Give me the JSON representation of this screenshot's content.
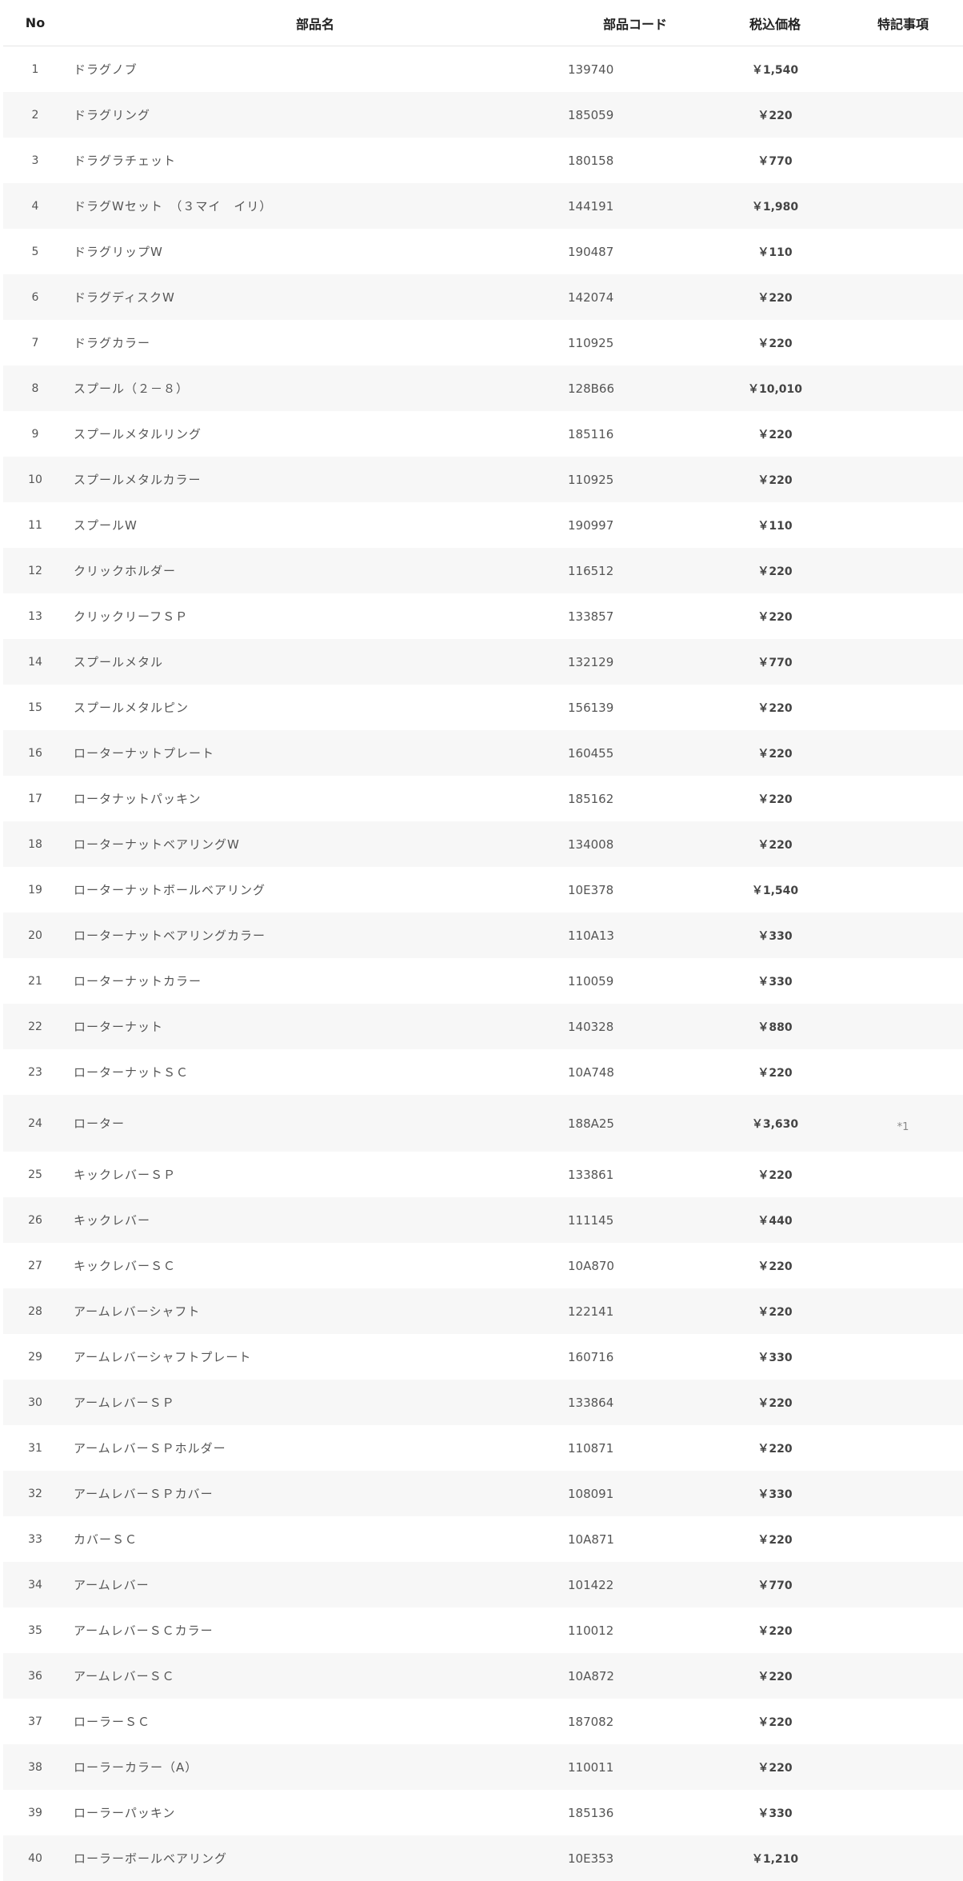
{
  "table": {
    "headers": {
      "no": "No",
      "name": "部品名",
      "code": "部品コード",
      "price": "税込価格",
      "note": "特記事項"
    },
    "rows": [
      {
        "no": "1",
        "name": "ドラグノブ",
        "code": "139740",
        "price": "￥1,540",
        "note": ""
      },
      {
        "no": "2",
        "name": "ドラグリング",
        "code": "185059",
        "price": "￥220",
        "note": ""
      },
      {
        "no": "3",
        "name": "ドラグラチェット",
        "code": "180158",
        "price": "￥770",
        "note": ""
      },
      {
        "no": "4",
        "name": "ドラグWセット　（３マイ　イリ）",
        "code": "144191",
        "price": "￥1,980",
        "note": ""
      },
      {
        "no": "5",
        "name": "ドラグリップW",
        "code": "190487",
        "price": "￥110",
        "note": ""
      },
      {
        "no": "6",
        "name": "ドラグディスクW",
        "code": "142074",
        "price": "￥220",
        "note": ""
      },
      {
        "no": "7",
        "name": "ドラグカラー",
        "code": "110925",
        "price": "￥220",
        "note": ""
      },
      {
        "no": "8",
        "name": "スプール（２－８）",
        "code": "128B66",
        "price": "￥10,010",
        "note": ""
      },
      {
        "no": "9",
        "name": "スプールメタルリング",
        "code": "185116",
        "price": "￥220",
        "note": ""
      },
      {
        "no": "10",
        "name": "スプールメタルカラー",
        "code": "110925",
        "price": "￥220",
        "note": ""
      },
      {
        "no": "11",
        "name": "スプールW",
        "code": "190997",
        "price": "￥110",
        "note": ""
      },
      {
        "no": "12",
        "name": "クリックホルダー",
        "code": "116512",
        "price": "￥220",
        "note": ""
      },
      {
        "no": "13",
        "name": "クリックリーフＳＰ",
        "code": "133857",
        "price": "￥220",
        "note": ""
      },
      {
        "no": "14",
        "name": "スプールメタル",
        "code": "132129",
        "price": "￥770",
        "note": ""
      },
      {
        "no": "15",
        "name": "スプールメタルピン",
        "code": "156139",
        "price": "￥220",
        "note": ""
      },
      {
        "no": "16",
        "name": "ローターナットプレート",
        "code": "160455",
        "price": "￥220",
        "note": ""
      },
      {
        "no": "17",
        "name": "ロータナットパッキン",
        "code": "185162",
        "price": "￥220",
        "note": ""
      },
      {
        "no": "18",
        "name": "ローターナットベアリングW",
        "code": "134008",
        "price": "￥220",
        "note": ""
      },
      {
        "no": "19",
        "name": "ローターナットボールベアリング",
        "code": "10E378",
        "price": "￥1,540",
        "note": ""
      },
      {
        "no": "20",
        "name": "ローターナットベアリングカラー",
        "code": "110A13",
        "price": "￥330",
        "note": ""
      },
      {
        "no": "21",
        "name": "ローターナットカラー",
        "code": "110059",
        "price": "￥330",
        "note": ""
      },
      {
        "no": "22",
        "name": "ローターナット",
        "code": "140328",
        "price": "￥880",
        "note": ""
      },
      {
        "no": "23",
        "name": "ローターナットＳＣ",
        "code": "10A748",
        "price": "￥220",
        "note": ""
      },
      {
        "no": "24",
        "name": "ローター",
        "code": "188A25",
        "price": "￥3,630",
        "note": "*1"
      },
      {
        "no": "25",
        "name": "キックレバーＳＰ",
        "code": "133861",
        "price": "￥220",
        "note": ""
      },
      {
        "no": "26",
        "name": "キックレバー",
        "code": "111145",
        "price": "￥440",
        "note": ""
      },
      {
        "no": "27",
        "name": "キックレバーＳＣ",
        "code": "10A870",
        "price": "￥220",
        "note": ""
      },
      {
        "no": "28",
        "name": "アームレバーシャフト",
        "code": "122141",
        "price": "￥220",
        "note": ""
      },
      {
        "no": "29",
        "name": "アームレバーシャフトプレート",
        "code": "160716",
        "price": "￥330",
        "note": ""
      },
      {
        "no": "30",
        "name": "アームレバーＳＰ",
        "code": "133864",
        "price": "￥220",
        "note": ""
      },
      {
        "no": "31",
        "name": "アームレバーＳＰホルダー",
        "code": "110871",
        "price": "￥220",
        "note": ""
      },
      {
        "no": "32",
        "name": "アームレバーＳＰカバー",
        "code": "108091",
        "price": "￥330",
        "note": ""
      },
      {
        "no": "33",
        "name": "カバーＳＣ",
        "code": "10A871",
        "price": "￥220",
        "note": ""
      },
      {
        "no": "34",
        "name": "アームレバー",
        "code": "101422",
        "price": "￥770",
        "note": ""
      },
      {
        "no": "35",
        "name": "アームレバーＳＣカラー",
        "code": "110012",
        "price": "￥220",
        "note": ""
      },
      {
        "no": "36",
        "name": "アームレバーＳＣ",
        "code": "10A872",
        "price": "￥220",
        "note": ""
      },
      {
        "no": "37",
        "name": "ローラーＳＣ",
        "code": "187082",
        "price": "￥220",
        "note": ""
      },
      {
        "no": "38",
        "name": "ローラーカラー（A）",
        "code": "110011",
        "price": "￥220",
        "note": ""
      },
      {
        "no": "39",
        "name": "ローラーパッキン",
        "code": "185136",
        "price": "￥330",
        "note": ""
      },
      {
        "no": "40",
        "name": "ローラーボールベアリング",
        "code": "10E353",
        "price": "￥1,210",
        "note": ""
      }
    ]
  }
}
